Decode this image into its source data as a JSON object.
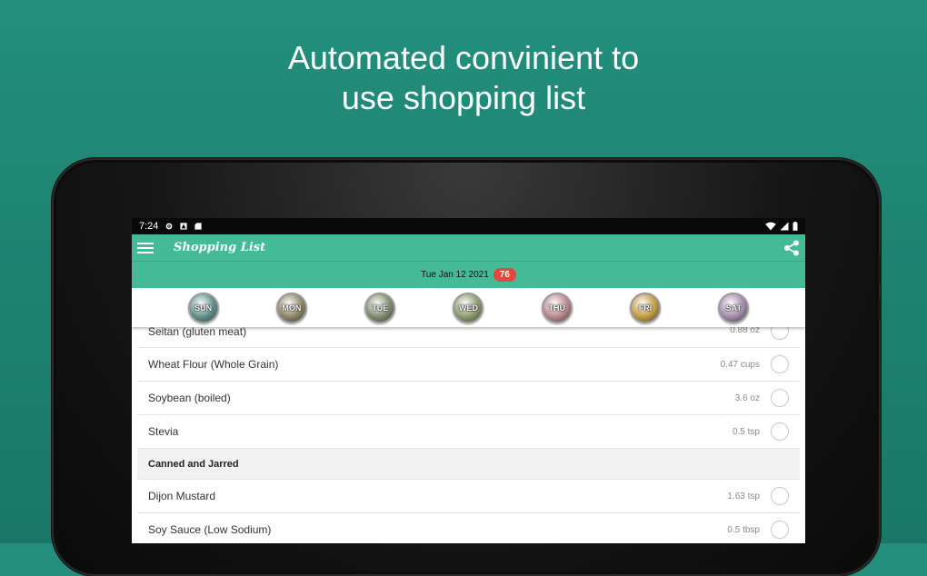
{
  "promo": {
    "line1": "Automated convinient to",
    "line2": "use shopping list"
  },
  "statusbar": {
    "time": "7:24"
  },
  "appbar": {
    "title": "Shopping List"
  },
  "datebar": {
    "date": "Tue Jan 12 2021",
    "badge": "76"
  },
  "days": [
    {
      "label": "SUN",
      "color": "#5f8f8a"
    },
    {
      "label": "MON",
      "color": "#8c8466"
    },
    {
      "label": "TUE",
      "color": "#7e8a6a"
    },
    {
      "label": "WED",
      "color": "#8a9a6a"
    },
    {
      "label": "THU",
      "color": "#b9868a"
    },
    {
      "label": "FRI",
      "color": "#c09a3e"
    },
    {
      "label": "SAT",
      "color": "#a18aa8"
    }
  ],
  "list": {
    "items_top": [
      {
        "name": "Seitan (gluten meat)",
        "qty": "0.88 oz"
      },
      {
        "name": "Wheat Flour (Whole Grain)",
        "qty": "0.47 cups"
      },
      {
        "name": "Soybean (boiled)",
        "qty": "3.6 oz"
      },
      {
        "name": "Stevia",
        "qty": "0.5 tsp"
      }
    ],
    "section": "Canned and Jarred",
    "items_bottom": [
      {
        "name": "Dijon Mustard",
        "qty": "1.63 tsp"
      },
      {
        "name": "Soy Sauce (Low Sodium)",
        "qty": "0.5 tbsp"
      }
    ]
  },
  "colors": {
    "accent": "#45ba96",
    "badge": "#e8463c",
    "background": "#1f8573"
  }
}
